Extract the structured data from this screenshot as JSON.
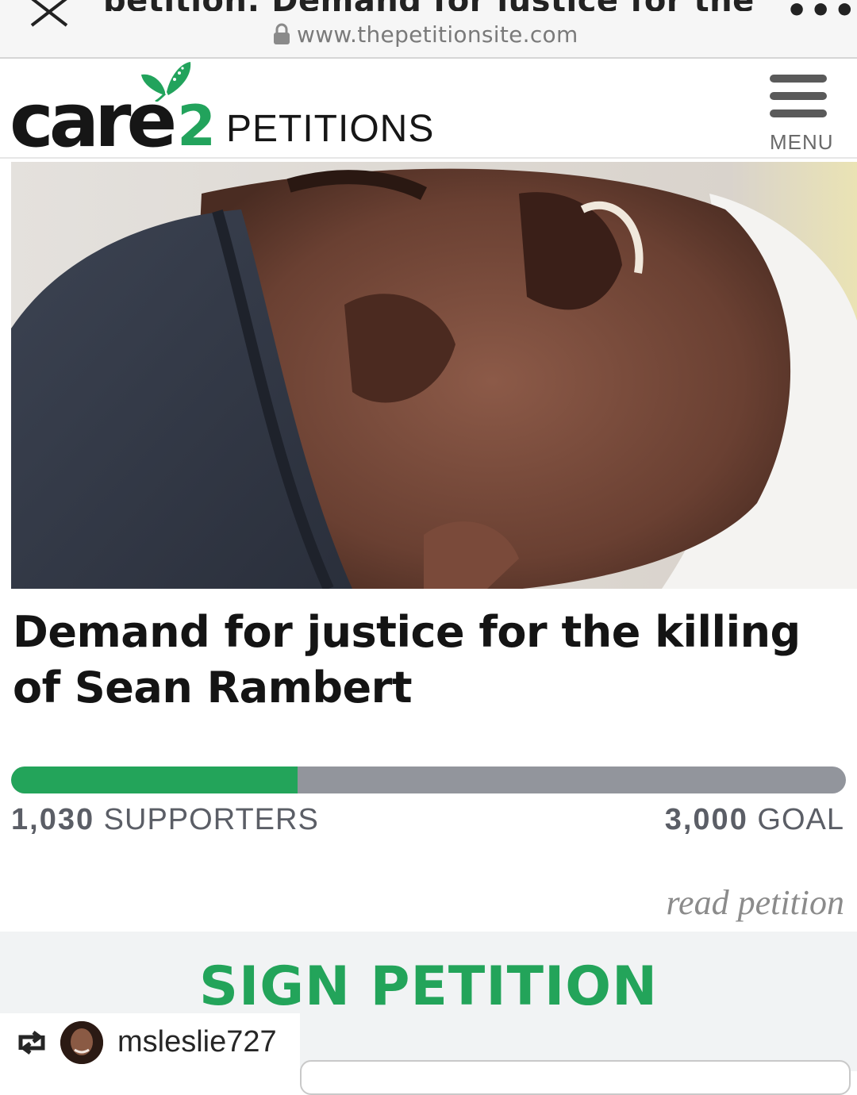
{
  "browser": {
    "tab_title": "petition: Demand for justice for the killin...",
    "url": "www.thepetitionsite.com",
    "more_label": "•••"
  },
  "header": {
    "logo_care": "care",
    "logo_two": "2",
    "logo_petitions": "PETITIONS",
    "menu_label": "MENU"
  },
  "petition": {
    "title": "Demand for justice for the killing of Sean Rambert",
    "supporters_count": "1,030",
    "supporters_label": "SUPPORTERS",
    "goal_count": "3,000",
    "goal_label": "GOAL",
    "progress_fraction": 0.343,
    "read_link": "read petition",
    "sign_label": "SIGN PETITION"
  },
  "repost": {
    "username": "msleslie727"
  },
  "colors": {
    "brand_green": "#23a45a",
    "progress_track": "#92959c"
  },
  "icons": [
    "close-icon",
    "lock-icon",
    "more-icon",
    "butterfly-icon",
    "menu-icon",
    "repost-icon"
  ]
}
